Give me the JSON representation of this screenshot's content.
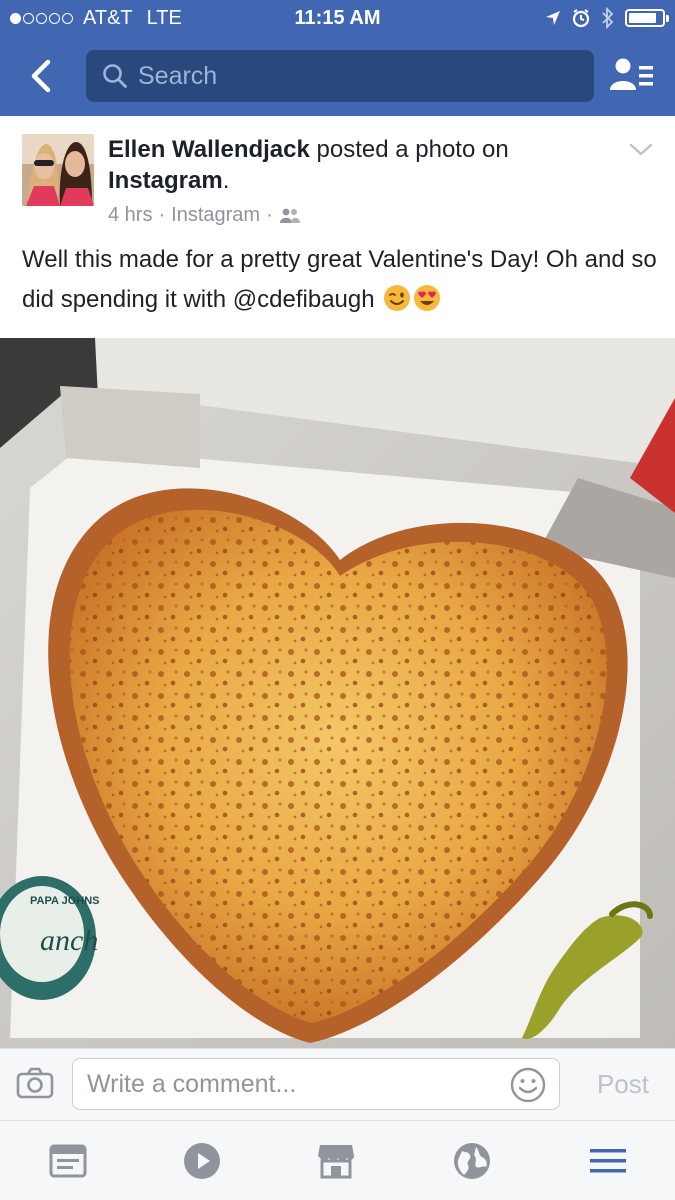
{
  "status_bar": {
    "carrier": "AT&T",
    "network": "LTE",
    "time": "11:15 AM",
    "signal_bars_filled": 1,
    "signal_bars_total": 5,
    "battery_level": 0.85
  },
  "nav": {
    "search_placeholder": "Search"
  },
  "post": {
    "author": "Ellen Wallendjack",
    "action": " posted a photo on ",
    "platform": "Instagram",
    "period": ".",
    "time_ago": "4 hrs",
    "separator": "·",
    "source": "Instagram",
    "audience_icon": "friends-icon",
    "message": "Well this made for a pretty great Valentine's Day! Oh and so did spending it with @cdefibaugh",
    "emojis": [
      "winking-face",
      "heart-eyes-face"
    ]
  },
  "comment": {
    "placeholder": "Write a comment...",
    "post_label": "Post"
  },
  "tabbar": {
    "tabs": [
      "news-feed-icon",
      "video-icon",
      "marketplace-icon",
      "notifications-globe-icon",
      "menu-icon"
    ],
    "active_color": "#4267b2",
    "inactive_color": "#90949c"
  },
  "colors": {
    "brand": "#4267b2",
    "search_bg": "#29487d"
  }
}
